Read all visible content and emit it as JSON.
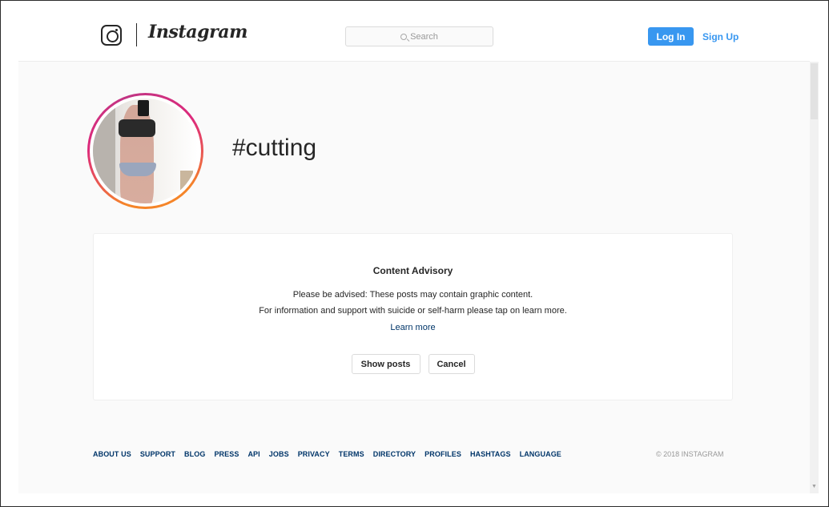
{
  "header": {
    "brand": "Instagram",
    "search_placeholder": "Search",
    "login_label": "Log In",
    "signup_label": "Sign Up",
    "icons": {
      "logo": "instagram-camera-icon",
      "search": "search-icon"
    }
  },
  "profile": {
    "hashtag": "#cutting"
  },
  "advisory": {
    "title": "Content Advisory",
    "line1": "Please be advised: These posts may contain graphic content.",
    "line2": "For information and support with suicide or self-harm please tap on learn more.",
    "learn_more": "Learn more",
    "show_posts": "Show posts",
    "cancel": "Cancel"
  },
  "footer": {
    "links": [
      "ABOUT US",
      "SUPPORT",
      "BLOG",
      "PRESS",
      "API",
      "JOBS",
      "PRIVACY",
      "TERMS",
      "DIRECTORY",
      "PROFILES",
      "HASHTAGS",
      "LANGUAGE"
    ],
    "copyright": "© 2018 INSTAGRAM"
  },
  "colors": {
    "primary_blue": "#3897f0",
    "link_dark_blue": "#003569",
    "text": "#262626",
    "muted": "#999999",
    "background": "#fafafa"
  }
}
